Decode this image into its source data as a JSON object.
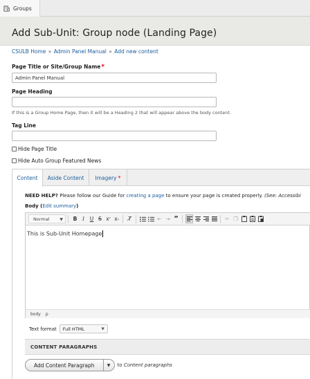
{
  "topbar": {
    "tab_label": "Groups",
    "tab_icon": "building-icon"
  },
  "header": {
    "title": "Add Sub-Unit: Group node (Landing Page)"
  },
  "breadcrumb": {
    "items": [
      "CSULB Home",
      "Admin Panel Manual",
      "Add new content"
    ],
    "separator": "»"
  },
  "fields": {
    "page_title": {
      "label": "Page Title or Site/Group Name",
      "required_mark": "*",
      "value": "Admin Panel Manual"
    },
    "page_heading": {
      "label": "Page Heading",
      "value": "",
      "description": "If this is a Group Home Page, then it will be a Heading 2 that will appear above the body content."
    },
    "tag_line": {
      "label": "Tag Line",
      "value": ""
    }
  },
  "checkboxes": {
    "hide_title": {
      "label": "Hide Page Title",
      "checked": false
    },
    "hide_news": {
      "label": "Hide Auto Group Featured News",
      "checked": false
    }
  },
  "tabs": [
    {
      "label": "Content",
      "active": true
    },
    {
      "label": "Aside Content",
      "active": false
    },
    {
      "label": "Imagery",
      "active": false,
      "required_mark": "*"
    }
  ],
  "help": {
    "prefix": "NEED HELP?",
    "text1": " Please follow our Guide for ",
    "link": "creating a page",
    "text2": " to ensure your page is created properly. ",
    "italic": "(See: Accessibi"
  },
  "body_field": {
    "label": "Body",
    "open_paren": " (",
    "edit_summary": "Edit summary",
    "close_paren": ")"
  },
  "editor": {
    "format_select": "Normal",
    "content": "This is Sub-Unit Homepage",
    "path": [
      "body",
      "p"
    ],
    "toolbar_icons": [
      "bold-icon",
      "italic-icon",
      "underline-icon",
      "strikethrough-icon",
      "superscript-icon",
      "subscript-icon",
      "remove-format-icon",
      "numbered-list-icon",
      "bulleted-list-icon",
      "outdent-icon",
      "indent-icon",
      "blockquote-icon",
      "align-left-icon",
      "align-center-icon",
      "align-right-icon",
      "justify-icon",
      "cut-icon",
      "copy-icon",
      "paste-icon",
      "paste-text-icon",
      "paste-word-icon"
    ]
  },
  "text_format": {
    "label": "Text format",
    "value": "Full HTML"
  },
  "content_paragraphs": {
    "header": "CONTENT PARAGRAPHS",
    "add_button": "Add Content Paragraph",
    "to_prefix": "to ",
    "to_target": "Content paragraphs"
  }
}
